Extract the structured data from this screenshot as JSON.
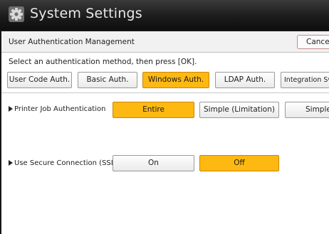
{
  "window": {
    "title": "System Settings",
    "icon": "settings-icon"
  },
  "header": {
    "title": "User Authentication Management",
    "cancel_label": "Cancel"
  },
  "instruction": "Select an authentication method, then press [OK].",
  "auth_methods": {
    "selected": "Windows Auth.",
    "items": [
      {
        "label": "User Code Auth."
      },
      {
        "label": "Basic Auth."
      },
      {
        "label": "Windows Auth."
      },
      {
        "label": "LDAP Auth."
      },
      {
        "label": "Integration Svr. Auth."
      }
    ]
  },
  "printer_job_auth": {
    "label": "Printer Job Authentication",
    "selected": "Entire",
    "options": [
      {
        "label": "Entire"
      },
      {
        "label": "Simple (Limitation)"
      },
      {
        "label": "Simple (All)"
      }
    ]
  },
  "secure_connection": {
    "label": "Use Secure Connection (SSL)",
    "selected": "Off",
    "options": [
      {
        "label": "On"
      },
      {
        "label": "Off"
      }
    ]
  },
  "colors": {
    "selected": "#fdb812",
    "title_bar": "#1c1c1c"
  }
}
